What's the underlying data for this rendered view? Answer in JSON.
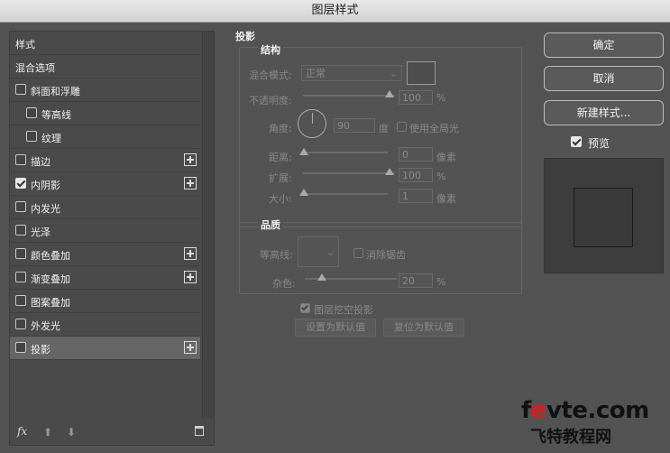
{
  "window": {
    "title": "图层样式"
  },
  "styles_list": {
    "items": [
      {
        "label": "样式",
        "has_checkbox": false,
        "checked": false,
        "has_plus": false,
        "indent": 0,
        "selected": false
      },
      {
        "label": "混合选项",
        "has_checkbox": false,
        "checked": false,
        "has_plus": false,
        "indent": 0,
        "selected": false
      },
      {
        "label": "斜面和浮雕",
        "has_checkbox": true,
        "checked": false,
        "has_plus": false,
        "indent": 0,
        "selected": false
      },
      {
        "label": "等高线",
        "has_checkbox": true,
        "checked": false,
        "has_plus": false,
        "indent": 1,
        "selected": false
      },
      {
        "label": "纹理",
        "has_checkbox": true,
        "checked": false,
        "has_plus": false,
        "indent": 1,
        "selected": false
      },
      {
        "label": "描边",
        "has_checkbox": true,
        "checked": false,
        "has_plus": true,
        "indent": 0,
        "selected": false
      },
      {
        "label": "内阴影",
        "has_checkbox": true,
        "checked": true,
        "has_plus": true,
        "indent": 0,
        "selected": false
      },
      {
        "label": "内发光",
        "has_checkbox": true,
        "checked": false,
        "has_plus": false,
        "indent": 0,
        "selected": false
      },
      {
        "label": "光泽",
        "has_checkbox": true,
        "checked": false,
        "has_plus": false,
        "indent": 0,
        "selected": false
      },
      {
        "label": "颜色叠加",
        "has_checkbox": true,
        "checked": false,
        "has_plus": true,
        "indent": 0,
        "selected": false
      },
      {
        "label": "渐变叠加",
        "has_checkbox": true,
        "checked": false,
        "has_plus": true,
        "indent": 0,
        "selected": false
      },
      {
        "label": "图案叠加",
        "has_checkbox": true,
        "checked": false,
        "has_plus": false,
        "indent": 0,
        "selected": false
      },
      {
        "label": "外发光",
        "has_checkbox": true,
        "checked": false,
        "has_plus": false,
        "indent": 0,
        "selected": false
      },
      {
        "label": "投影",
        "has_checkbox": true,
        "checked": false,
        "has_plus": true,
        "indent": 0,
        "selected": true
      }
    ],
    "bottom": {
      "fx_label": "fx",
      "up_icon": "arrow-up-icon",
      "down_icon": "arrow-down-icon",
      "trash_icon": "trash-icon"
    }
  },
  "drop_shadow": {
    "section_title": "投影",
    "structure": {
      "title": "结构",
      "blend_mode_label": "混合模式:",
      "blend_mode_value": "正常",
      "opacity_label": "不透明度:",
      "opacity_value": "100",
      "opacity_unit": "%",
      "opacity_level": 1.0,
      "angle_label": "角度:",
      "angle_value": "90",
      "angle_unit": "度",
      "global_light_label": "使用全局光",
      "global_light_checked": false,
      "distance_label": "距离:",
      "distance_value": "0",
      "distance_unit": "像素",
      "spread_label": "扩展:",
      "spread_value": "100",
      "spread_unit": "%",
      "size_label": "大小:",
      "size_value": "1",
      "size_unit": "像素"
    },
    "quality": {
      "title": "品质",
      "contour_label": "等高线:",
      "antialias_label": "消除锯齿",
      "antialias_checked": false,
      "noise_label": "杂色:",
      "noise_value": "20",
      "noise_unit": "%"
    },
    "layer_knockout_label": "图层挖空投影",
    "layer_knockout_checked": true,
    "set_default_label": "设置为默认值",
    "reset_default_label": "复位为默认值"
  },
  "buttons": {
    "ok_label": "确定",
    "cancel_label": "取消",
    "new_style_label": "新建样式...",
    "preview_label": "预览",
    "preview_checked": true
  },
  "watermark": {
    "line1_prefix": "f",
    "line1_red": "e",
    "line1_rest": "vte.com",
    "line2": "飞特教程网"
  }
}
